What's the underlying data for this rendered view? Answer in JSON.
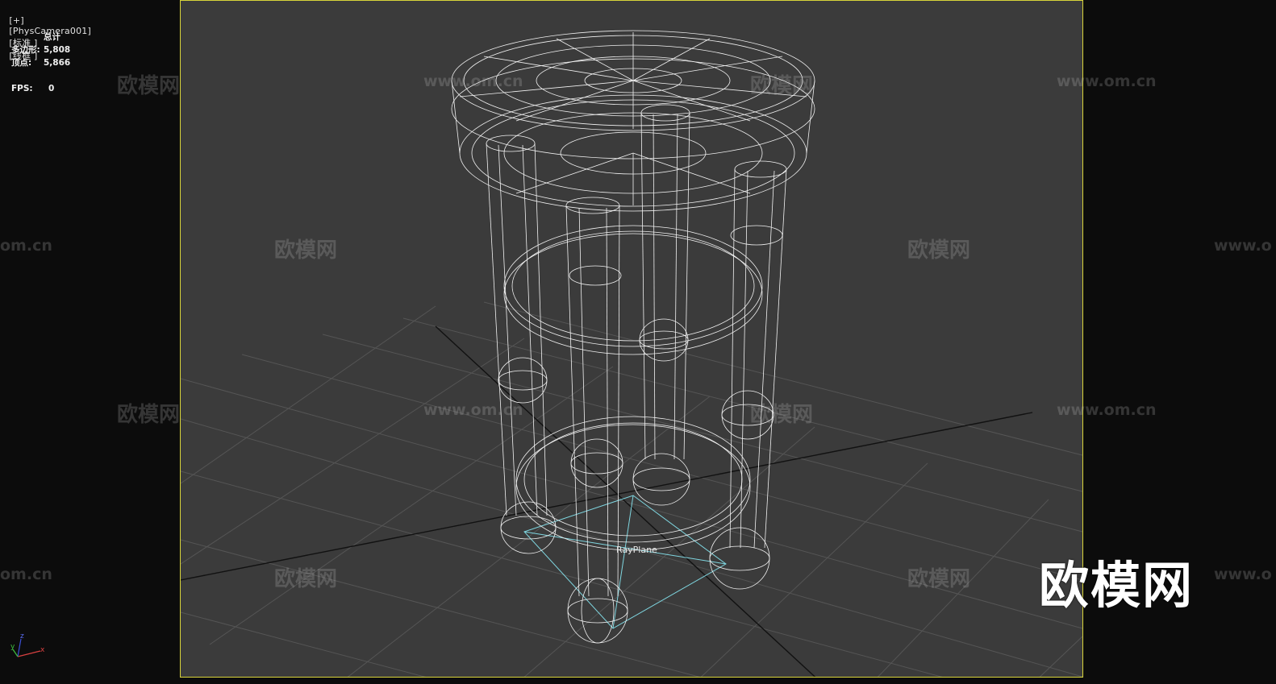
{
  "viewport": {
    "labels": [
      "[+]",
      "[PhysCamera001]",
      "[标准 ]",
      "[线框 ]"
    ]
  },
  "stats": {
    "header": "总计",
    "polygons_label": "多边形:",
    "polygons_value": "5,808",
    "vertices_label": "顶点:",
    "vertices_value": "5,866",
    "fps_label": "FPS:",
    "fps_value": "0"
  },
  "object_label": "RayPlane",
  "watermark": {
    "brand": "欧模网",
    "url": "www.om.cn",
    "url_partial_left": "om.cn",
    "url_partial_right": "www.o"
  },
  "logo": "欧模网",
  "axis": {
    "x": "x",
    "y": "y",
    "z": "z"
  },
  "colors": {
    "viewport_bg": "#3b3b3b",
    "outer_bg": "#0c0c0c",
    "safe_frame": "#d8d43a",
    "wireframe": "#f0f0f0",
    "grid": "#5a5a5a",
    "rayplane": "#7fd6e0"
  }
}
